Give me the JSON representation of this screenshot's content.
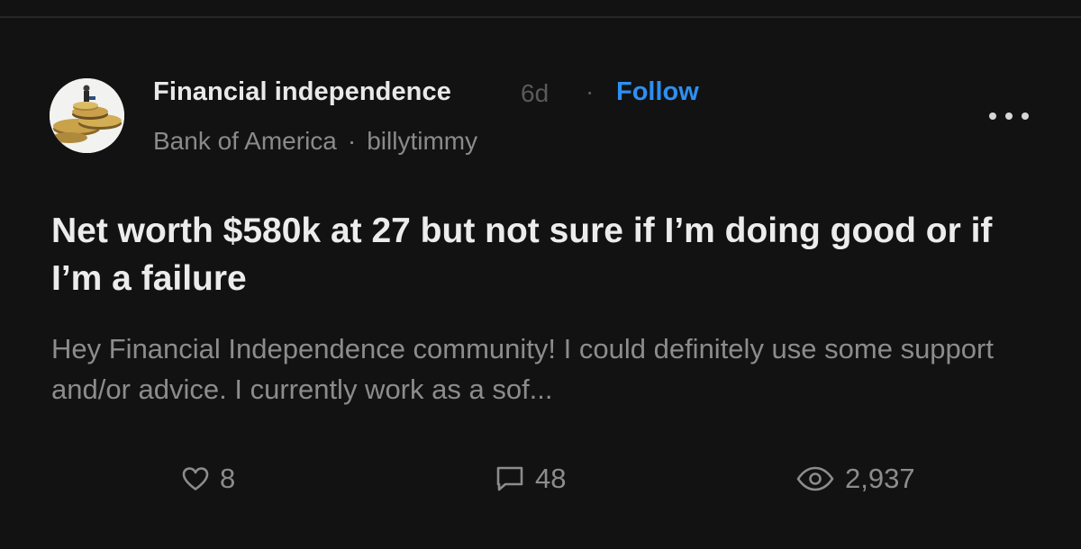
{
  "post": {
    "community": "Financial independence",
    "time_ago": "6d",
    "separator": "·",
    "follow_label": "Follow",
    "company": "Bank of America",
    "author": "billytimmy",
    "title": "Net worth $580k at 27 but not sure if I’m doing good or if I’m a failure",
    "excerpt": "Hey Financial Independence community!  I could definitely use some support and/or advice.  I currently work as a sof...",
    "likes": "8",
    "comments": "48",
    "views": "2,937"
  },
  "icons": {
    "more": "more-horizontal-icon",
    "like": "heart-icon",
    "comment": "comment-bubble-icon",
    "views": "eye-icon"
  },
  "colors": {
    "background": "#121212",
    "follow_accent": "#2d8ff2",
    "muted_text": "#8c8c8c"
  }
}
